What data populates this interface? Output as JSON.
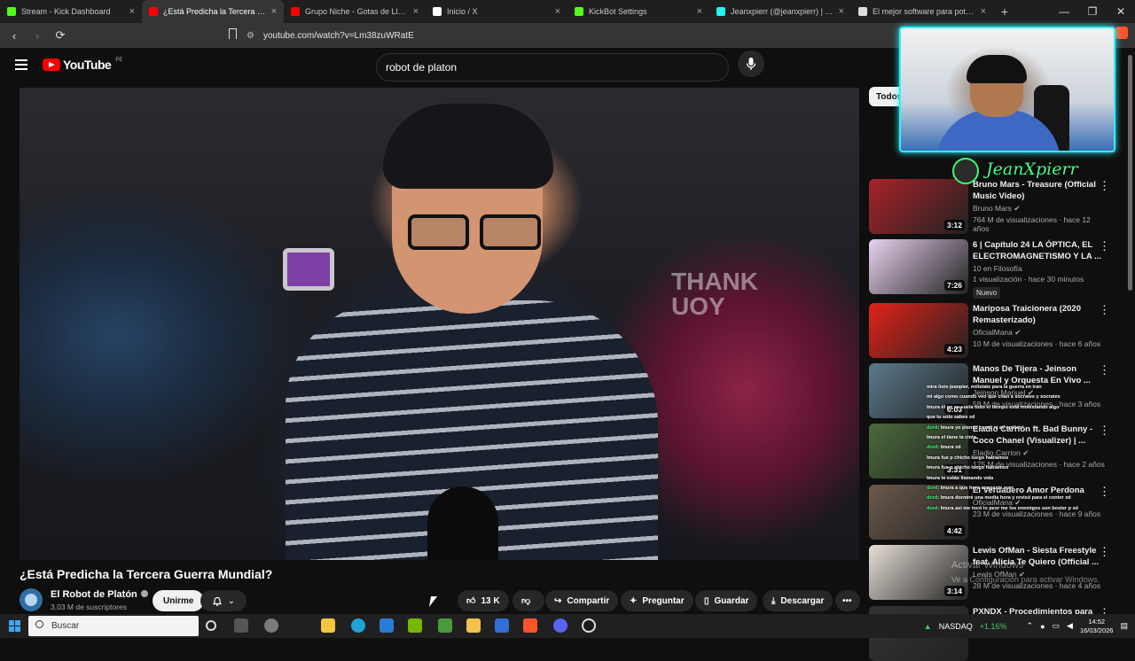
{
  "browser": {
    "tabs": [
      {
        "title": "Stream - Kick Dashboard",
        "color": "#53fc18",
        "active": false
      },
      {
        "title": "¿Está Predicha la Tercera Gue",
        "color": "#ff0000",
        "active": true
      },
      {
        "title": "Grupo Niche - Gotas de Lluvia | Letra",
        "color": "#ff0000",
        "active": false
      },
      {
        "title": "Inicio / X",
        "color": "#ffffff",
        "active": false
      },
      {
        "title": "KickBot Settings",
        "color": "#53fc18",
        "active": false
      },
      {
        "title": "Jeanxpierr (@jeanxpierr) | TikTok",
        "color": "#25f4ee",
        "active": false
      },
      {
        "title": "El mejor software para potenciar tu",
        "color": "#dddddd",
        "active": false
      }
    ],
    "url": "youtube.com/watch?v=Lm38zuWRatE"
  },
  "youtube": {
    "logo_text": "YouTube",
    "country": "PE",
    "search_value": "robot de platon"
  },
  "video": {
    "thumbnail_text": "THANK\nYOU",
    "title": "¿Está Predicha la Tercera Guerra Mundial?",
    "channel": "El Robot de Platón",
    "subscribers": "3,03 M de suscriptores",
    "join_label": "Unirme",
    "likes": "13 K",
    "share_label": "Compartir",
    "ask_label": "Preguntar",
    "save_label": "Guardar",
    "download_label": "Descargar"
  },
  "sidebar": {
    "chip": "Todos",
    "items": [
      {
        "title": "Bruno Mars - Treasure (Official Music Video)",
        "channel": "Bruno Mars",
        "verified": true,
        "meta": "764 M de visualizaciones · hace 12 años",
        "duration": "3:12",
        "thumb": "#a8232a",
        "new": false
      },
      {
        "title": "6 | Capítulo 24 LA ÓPTICA, EL ELECTROMAGNETISMO Y LA ...",
        "channel": "10 en Filosofía",
        "verified": false,
        "meta": "1 visualización · hace 30 minutos",
        "duration": "7:26",
        "thumb": "#e9d2ef",
        "new": true,
        "badge": "Nuevo"
      },
      {
        "title": "Mariposa Traicionera (2020 Remasterizado)",
        "channel": "OficialMana",
        "verified": true,
        "meta": "10 M de visualizaciones · hace 6 años",
        "duration": "4:23",
        "thumb": "#e32218",
        "new": false
      },
      {
        "title": "Manos De Tijera - Jeinson Manuel y Orquesta En Vivo ...",
        "channel": "Jeinson Manuel",
        "verified": true,
        "meta": "58 M de visualizaciones · hace 3 años",
        "duration": "6:03",
        "thumb": "#5b7a8c",
        "new": false
      },
      {
        "title": "Eladio Carrión ft. Bad Bunny - Coco Chanel (Visualizer) | ...",
        "channel": "Eladio Carrion",
        "verified": true,
        "meta": "175 M de visualizaciones · hace 2 años",
        "duration": "3:31",
        "thumb": "#4b6a3b",
        "new": false
      },
      {
        "title": "El Verdadero Amor Perdona",
        "channel": "OficialMana",
        "verified": true,
        "meta": "23 M de visualizaciones · hace 9 años",
        "duration": "4:42",
        "thumb": "#6b5a4c",
        "new": false
      },
      {
        "title": "Lewis OfMan - Siesta Freestyle feat. Alicia Te Quiero (Official ...",
        "channel": "Lewis OfMan",
        "verified": true,
        "meta": "28 M de visualizaciones · hace 4 años",
        "duration": "3:14",
        "thumb": "#e8e0d8",
        "new": false
      },
      {
        "title": "PXNDX - Procedimientos para",
        "channel": "",
        "verified": false,
        "meta": "",
        "duration": "",
        "thumb": "#333333",
        "new": false
      }
    ]
  },
  "stream_overlay": {
    "streamer_name": "JeanXpierr",
    "chat": [
      {
        "user": "",
        "text": "mira listo jeanpier, enlistate para la guerra en iran"
      },
      {
        "user": "",
        "text": "mi algo como cuando veo que citan a socrates y socrates"
      },
      {
        "user": "",
        "text": "lmura él pq se vuela todo el tiempo está molestando algo"
      },
      {
        "user": "",
        "text": "que tu solo sabes xd"
      },
      {
        "user": "dord",
        "text": "lmura yo pienso como ni sé arribas"
      },
      {
        "user": "",
        "text": "lmura el tiene la cinta"
      },
      {
        "user": "dord",
        "text": "lmura xd"
      },
      {
        "user": "",
        "text": "lmura fue p chicho luego hablamos"
      },
      {
        "user": "",
        "text": "lmura fue p chicho luego hablamos"
      },
      {
        "user": "",
        "text": "lmura te estás llamando vida"
      },
      {
        "user": "dord",
        "text": "lmura a que hora apagaste ayer"
      },
      {
        "user": "dord",
        "text": "lmura dormiré una media hora y revisó para el conter xd"
      },
      {
        "user": "dord",
        "text": "lmura así me tocó lo peor me los enemigos son boster p xd"
      }
    ],
    "watermark_line1": "Activar Windows",
    "watermark_line2": "Ve a Configuración para activar Windows."
  },
  "taskbar": {
    "search_placeholder": "Buscar",
    "ticker_name": "NASDAQ",
    "ticker_change": "+1.16%",
    "time": "14:52",
    "date": "16/03/2026"
  }
}
